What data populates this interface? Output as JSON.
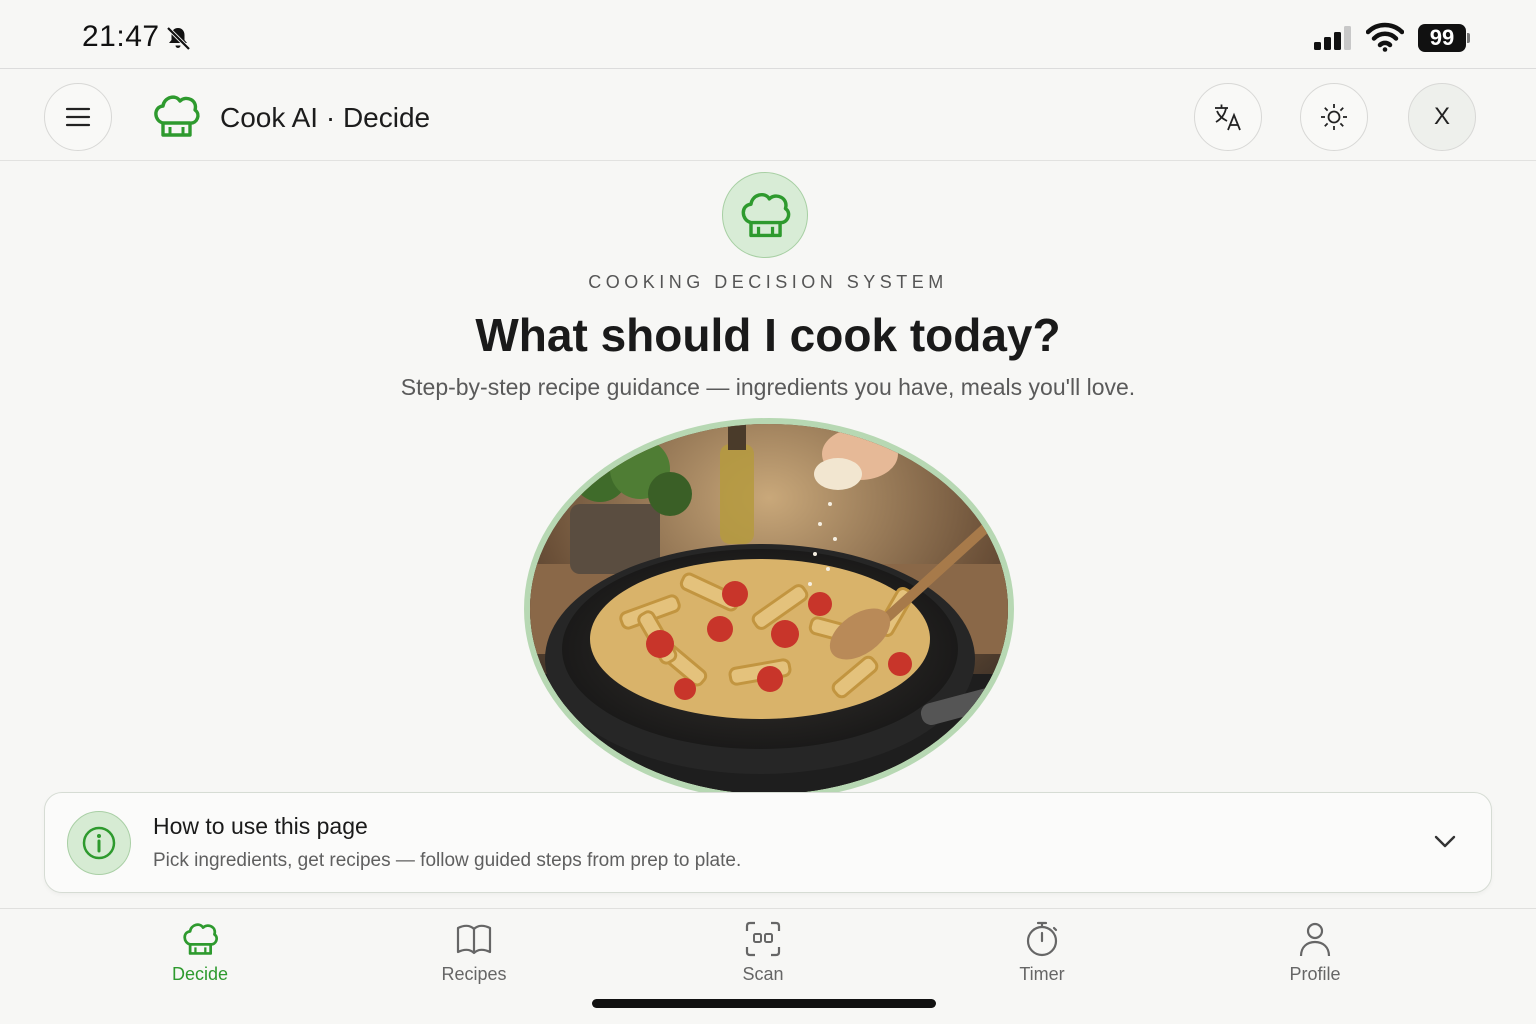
{
  "status_bar": {
    "time": "21:47",
    "battery": "99",
    "icons": [
      "bell-off-icon",
      "cellular-signal-icon",
      "wifi-icon",
      "battery-icon"
    ]
  },
  "header": {
    "title": "Cook AI · Decide",
    "buttons": [
      "menu-icon",
      "translate-icon",
      "sun-icon"
    ],
    "close_label": "X"
  },
  "hero": {
    "eyebrow": "COOKING DECISION SYSTEM",
    "headline": "What should I cook today?",
    "subhead": "Step-by-step recipe guidance — ingredients you have, meals you'll love.",
    "image_subject": "penne-pasta-with-cherry-tomatoes-in-pan"
  },
  "info_card": {
    "title": "How to use this page",
    "description": "Pick ingredients, get recipes — follow guided steps from prep to plate."
  },
  "tabs": [
    {
      "label": "Decide",
      "icon": "chef-hat-icon",
      "active": true
    },
    {
      "label": "Recipes",
      "icon": "book-icon",
      "active": false
    },
    {
      "label": "Scan",
      "icon": "scan-icon",
      "active": false
    },
    {
      "label": "Timer",
      "icon": "timer-icon",
      "active": false
    },
    {
      "label": "Profile",
      "icon": "user-icon",
      "active": false
    }
  ],
  "colors": {
    "accent": "#2e9a2e",
    "accent_light": "#d8ecd6",
    "background": "#f7f7f5",
    "text": "#1a1a1a"
  }
}
